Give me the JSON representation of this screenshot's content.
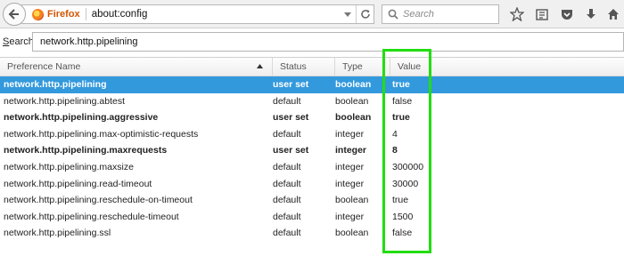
{
  "toolbar": {
    "identity_label": "Firefox",
    "url": "about:config",
    "search_placeholder": "Search"
  },
  "filter": {
    "label_prefix": "S",
    "label_rest": "earch:",
    "value": "network.http.pipelining"
  },
  "columns": {
    "name": "Preference Name",
    "status": "Status",
    "type": "Type",
    "value": "Value"
  },
  "rows": [
    {
      "name": "network.http.pipelining",
      "status": "user set",
      "type": "boolean",
      "value": "true"
    },
    {
      "name": "network.http.pipelining.abtest",
      "status": "default",
      "type": "boolean",
      "value": "false"
    },
    {
      "name": "network.http.pipelining.aggressive",
      "status": "user set",
      "type": "boolean",
      "value": "true"
    },
    {
      "name": "network.http.pipelining.max-optimistic-requests",
      "status": "default",
      "type": "integer",
      "value": "4"
    },
    {
      "name": "network.http.pipelining.maxrequests",
      "status": "user set",
      "type": "integer",
      "value": "8"
    },
    {
      "name": "network.http.pipelining.maxsize",
      "status": "default",
      "type": "integer",
      "value": "300000"
    },
    {
      "name": "network.http.pipelining.read-timeout",
      "status": "default",
      "type": "integer",
      "value": "30000"
    },
    {
      "name": "network.http.pipelining.reschedule-on-timeout",
      "status": "default",
      "type": "boolean",
      "value": "true"
    },
    {
      "name": "network.http.pipelining.reschedule-timeout",
      "status": "default",
      "type": "integer",
      "value": "1500"
    },
    {
      "name": "network.http.pipelining.ssl",
      "status": "default",
      "type": "boolean",
      "value": "false"
    }
  ],
  "selected_row": 0,
  "colors": {
    "selection": "#3399dd",
    "highlight_box": "#22dd11",
    "firefox_label": "#d35400"
  }
}
